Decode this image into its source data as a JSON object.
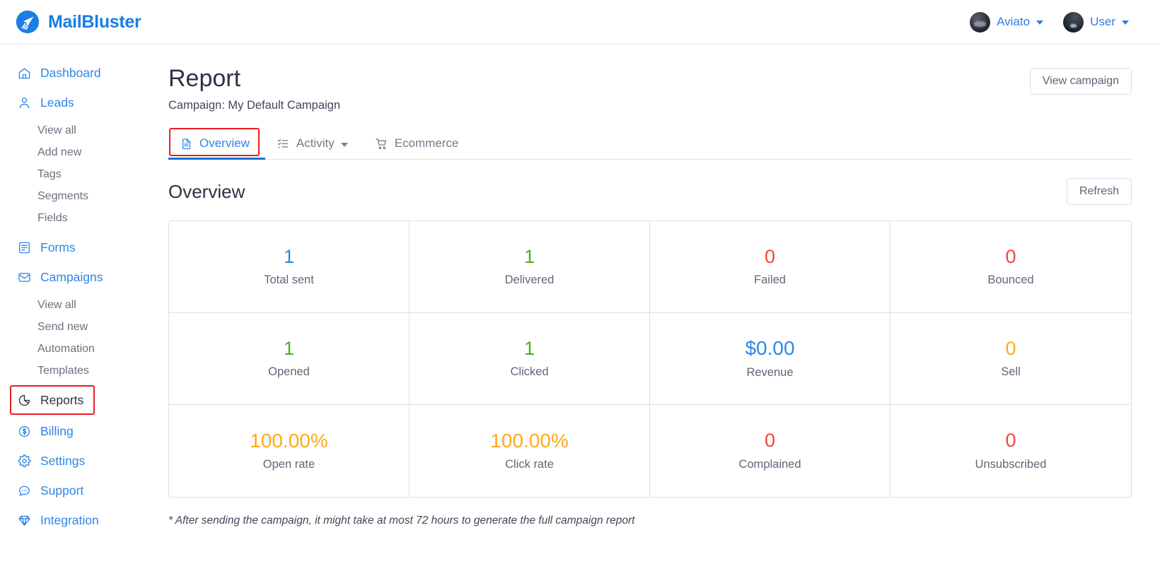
{
  "topbar": {
    "brand_name": "MailBluster",
    "brand_icon": "mailbluster-logo-icon",
    "accounts": [
      {
        "label": "Aviato",
        "icon": "avatar",
        "caret": "chevron-down-icon"
      },
      {
        "label": "User",
        "icon": "avatar",
        "caret": "chevron-down-icon"
      }
    ]
  },
  "sidebar": {
    "items": [
      {
        "label": "Dashboard",
        "icon": "home-icon",
        "type": "main",
        "active": false
      },
      {
        "label": "Leads",
        "icon": "user-icon",
        "type": "main",
        "active": false
      },
      {
        "label": "View all",
        "type": "sub"
      },
      {
        "label": "Add new",
        "type": "sub"
      },
      {
        "label": "Tags",
        "type": "sub"
      },
      {
        "label": "Segments",
        "type": "sub"
      },
      {
        "label": "Fields",
        "type": "sub"
      },
      {
        "label": "Forms",
        "icon": "form-icon",
        "type": "main",
        "active": false
      },
      {
        "label": "Campaigns",
        "icon": "envelope-icon",
        "type": "main",
        "active": false
      },
      {
        "label": "View all",
        "type": "sub"
      },
      {
        "label": "Send new",
        "type": "sub"
      },
      {
        "label": "Automation",
        "type": "sub"
      },
      {
        "label": "Templates",
        "type": "sub"
      },
      {
        "label": "Reports",
        "icon": "pie-chart-icon",
        "type": "main",
        "active": true
      },
      {
        "label": "Billing",
        "icon": "dollar-circle-icon",
        "type": "main",
        "active": false
      },
      {
        "label": "Settings",
        "icon": "gear-icon",
        "type": "main",
        "active": false
      },
      {
        "label": "Support",
        "icon": "chat-bubble-icon",
        "type": "main",
        "active": false
      },
      {
        "label": "Integration",
        "icon": "diamond-icon",
        "type": "main",
        "active": false
      }
    ]
  },
  "main": {
    "title": "Report",
    "subtitle": "Campaign: My Default Campaign",
    "view_campaign_label": "View campaign",
    "tabs": [
      {
        "label": "Overview",
        "icon": "document-icon",
        "active": true,
        "caret": false
      },
      {
        "label": "Activity",
        "icon": "checklist-icon",
        "active": false,
        "caret": true
      },
      {
        "label": "Ecommerce",
        "icon": "shopping-cart-icon",
        "active": false,
        "caret": false
      }
    ],
    "section_title": "Overview",
    "refresh_label": "Refresh",
    "note": "* After sending the campaign, it might take at most 72 hours to generate the full campaign report"
  },
  "colors": {
    "blue": "#2f86e8",
    "green": "#4caf1f",
    "red": "#f0453a",
    "orange": "#fdaa1b",
    "brand": "#1a7ee5",
    "highlight": "#ee1c24"
  },
  "stats": [
    {
      "value": "1",
      "label": "Total sent",
      "color": "#2f86e8"
    },
    {
      "value": "1",
      "label": "Delivered",
      "color": "#4caf1f"
    },
    {
      "value": "0",
      "label": "Failed",
      "color": "#f0453a"
    },
    {
      "value": "0",
      "label": "Bounced",
      "color": "#f0453a"
    },
    {
      "value": "1",
      "label": "Opened",
      "color": "#4caf1f"
    },
    {
      "value": "1",
      "label": "Clicked",
      "color": "#4caf1f"
    },
    {
      "value": "$0.00",
      "label": "Revenue",
      "color": "#2f86e8"
    },
    {
      "value": "0",
      "label": "Sell",
      "color": "#fdaa1b"
    },
    {
      "value": "100.00%",
      "label": "Open rate",
      "color": "#fdaa1b"
    },
    {
      "value": "100.00%",
      "label": "Click rate",
      "color": "#fdaa1b"
    },
    {
      "value": "0",
      "label": "Complained",
      "color": "#f0453a"
    },
    {
      "value": "0",
      "label": "Unsubscribed",
      "color": "#f0453a"
    }
  ]
}
